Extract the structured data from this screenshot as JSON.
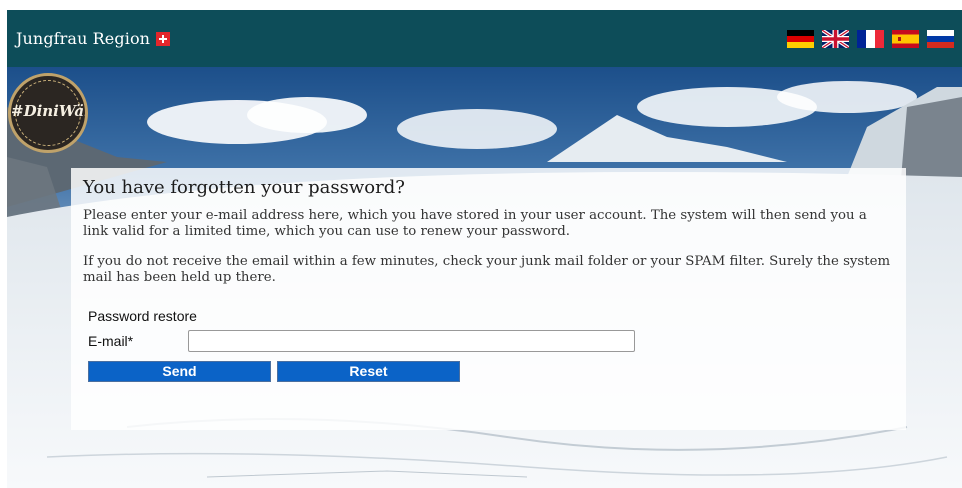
{
  "header": {
    "brand": "Jungfrau Region",
    "languages": [
      {
        "name": "German",
        "icon": "flag-de-icon"
      },
      {
        "name": "English",
        "icon": "flag-uk-icon"
      },
      {
        "name": "French",
        "icon": "flag-fr-icon"
      },
      {
        "name": "Spanish",
        "icon": "flag-es-icon"
      },
      {
        "name": "Russian",
        "icon": "flag-ru-icon"
      }
    ]
  },
  "logo": {
    "text": "#DiniWält"
  },
  "main": {
    "title": "You have forgotten your password?",
    "paragraph1": "Please enter your e-mail address here, which you have stored in your user account. The system will then send you a link valid for a limited time, which you can use to renew your password.",
    "paragraph2": "If you do not receive the email within a few minutes, check your junk mail folder or your SPAM filter. Surely the system mail has been held up there."
  },
  "form": {
    "legend": "Password restore",
    "email_label": "E-mail*",
    "email_value": "",
    "send_label": "Send",
    "reset_label": "Reset"
  },
  "colors": {
    "header_bg": "#0d4d59",
    "button_bg": "#0b63c7",
    "swiss_red": "#e3262b"
  }
}
